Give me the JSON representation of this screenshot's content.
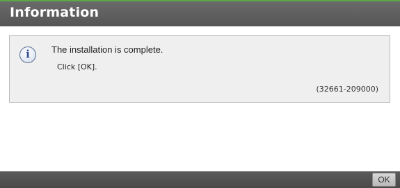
{
  "dialog": {
    "title": "Information"
  },
  "message": {
    "icon": "info-icon",
    "main": "The installation is complete.",
    "sub": "Click [OK].",
    "code": "(32661-209000)"
  },
  "footer": {
    "ok_label": "OK"
  },
  "colors": {
    "accent_line": "#5fa84a",
    "titlebar": "#5f5f5f",
    "message_box": "#efefef",
    "footer": "#505050"
  }
}
